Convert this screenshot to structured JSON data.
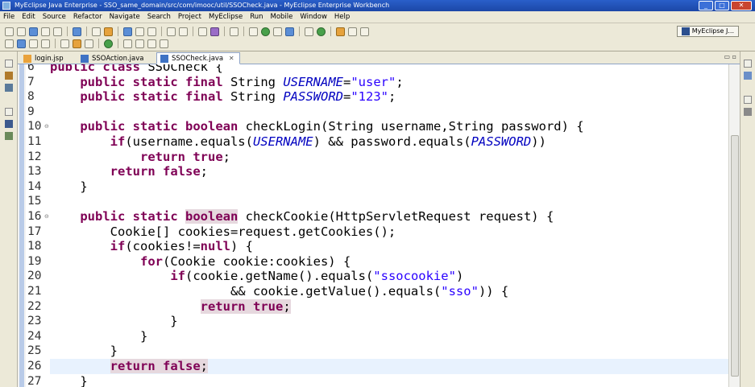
{
  "window": {
    "title": "MyEclipse Java Enterprise - SSO_same_domain/src/com/imooc/util/SSOCheck.java - MyEclipse Enterprise Workbench",
    "minimize": "_",
    "maximize": "□",
    "close": "✕"
  },
  "menu": [
    "File",
    "Edit",
    "Source",
    "Refactor",
    "Navigate",
    "Search",
    "Project",
    "MyEclipse",
    "Run",
    "Mobile",
    "Window",
    "Help"
  ],
  "perspective": {
    "label": "MyEclipse J..."
  },
  "tabs": [
    {
      "label": "login.jsp",
      "icon": "jsp-file-icon"
    },
    {
      "label": "SSOAction.java",
      "icon": "java-file-icon"
    },
    {
      "label": "SSOCheck.java",
      "icon": "java-file-icon",
      "active": true,
      "close": "✕"
    }
  ],
  "tab_controls": "▭ ▫",
  "editor": {
    "lines": [
      {
        "n": "6",
        "fold": "",
        "segs": [
          {
            "t": "kw",
            "v": "public"
          },
          {
            "t": "",
            "v": " "
          },
          {
            "t": "kw",
            "v": "class"
          },
          {
            "t": "",
            "v": " SSOCheck {"
          }
        ]
      },
      {
        "n": "7",
        "fold": "",
        "segs": [
          {
            "t": "",
            "v": "    "
          },
          {
            "t": "kw",
            "v": "public"
          },
          {
            "t": "",
            "v": " "
          },
          {
            "t": "kw",
            "v": "static"
          },
          {
            "t": "",
            "v": " "
          },
          {
            "t": "kw",
            "v": "final"
          },
          {
            "t": "",
            "v": " String "
          },
          {
            "t": "con",
            "v": "USERNAME"
          },
          {
            "t": "",
            "v": "="
          },
          {
            "t": "str",
            "v": "\"user\""
          },
          {
            "t": "",
            "v": ";"
          }
        ]
      },
      {
        "n": "8",
        "fold": "",
        "segs": [
          {
            "t": "",
            "v": "    "
          },
          {
            "t": "kw",
            "v": "public"
          },
          {
            "t": "",
            "v": " "
          },
          {
            "t": "kw",
            "v": "static"
          },
          {
            "t": "",
            "v": " "
          },
          {
            "t": "kw",
            "v": "final"
          },
          {
            "t": "",
            "v": " String "
          },
          {
            "t": "con",
            "v": "PASSWORD"
          },
          {
            "t": "",
            "v": "="
          },
          {
            "t": "str",
            "v": "\"123\""
          },
          {
            "t": "",
            "v": ";"
          }
        ]
      },
      {
        "n": "9",
        "fold": "",
        "segs": []
      },
      {
        "n": "10",
        "fold": "⊖",
        "segs": [
          {
            "t": "",
            "v": "    "
          },
          {
            "t": "kw",
            "v": "public"
          },
          {
            "t": "",
            "v": " "
          },
          {
            "t": "kw",
            "v": "static"
          },
          {
            "t": "",
            "v": " "
          },
          {
            "t": "kw",
            "v": "boolean"
          },
          {
            "t": "",
            "v": " checkLogin(String username,String password) {"
          }
        ]
      },
      {
        "n": "11",
        "fold": "",
        "segs": [
          {
            "t": "",
            "v": "        "
          },
          {
            "t": "kw",
            "v": "if"
          },
          {
            "t": "",
            "v": "(username.equals("
          },
          {
            "t": "con",
            "v": "USERNAME"
          },
          {
            "t": "",
            "v": ") && password.equals("
          },
          {
            "t": "con",
            "v": "PASSWORD"
          },
          {
            "t": "",
            "v": "))"
          }
        ]
      },
      {
        "n": "12",
        "fold": "",
        "segs": [
          {
            "t": "",
            "v": "            "
          },
          {
            "t": "kw",
            "v": "return"
          },
          {
            "t": "",
            "v": " "
          },
          {
            "t": "kw",
            "v": "true"
          },
          {
            "t": "",
            "v": ";"
          }
        ]
      },
      {
        "n": "13",
        "fold": "",
        "segs": [
          {
            "t": "",
            "v": "        "
          },
          {
            "t": "kw",
            "v": "return"
          },
          {
            "t": "",
            "v": " "
          },
          {
            "t": "kw",
            "v": "false"
          },
          {
            "t": "",
            "v": ";"
          }
        ]
      },
      {
        "n": "14",
        "fold": "",
        "segs": [
          {
            "t": "",
            "v": "    }"
          }
        ]
      },
      {
        "n": "15",
        "fold": "",
        "segs": []
      },
      {
        "n": "16",
        "fold": "⊖",
        "segs": [
          {
            "t": "",
            "v": "    "
          },
          {
            "t": "kw",
            "v": "public"
          },
          {
            "t": "",
            "v": " "
          },
          {
            "t": "kw",
            "v": "static"
          },
          {
            "t": "",
            "v": " "
          },
          {
            "t": "kw hl",
            "v": "boolean"
          },
          {
            "t": "",
            "v": " checkCookie(HttpServletRequest request) {"
          }
        ]
      },
      {
        "n": "17",
        "fold": "",
        "segs": [
          {
            "t": "",
            "v": "        Cookie[] cookies=request.getCookies();"
          }
        ]
      },
      {
        "n": "18",
        "fold": "",
        "segs": [
          {
            "t": "",
            "v": "        "
          },
          {
            "t": "kw",
            "v": "if"
          },
          {
            "t": "",
            "v": "(cookies!="
          },
          {
            "t": "kw",
            "v": "null"
          },
          {
            "t": "",
            "v": ") {"
          }
        ]
      },
      {
        "n": "19",
        "fold": "",
        "segs": [
          {
            "t": "",
            "v": "            "
          },
          {
            "t": "kw",
            "v": "for"
          },
          {
            "t": "",
            "v": "(Cookie cookie:cookies) {"
          }
        ]
      },
      {
        "n": "20",
        "fold": "",
        "segs": [
          {
            "t": "",
            "v": "                "
          },
          {
            "t": "kw",
            "v": "if"
          },
          {
            "t": "",
            "v": "(cookie.getName().equals("
          },
          {
            "t": "str",
            "v": "\"ssocookie\""
          },
          {
            "t": "",
            "v": ")"
          }
        ]
      },
      {
        "n": "21",
        "fold": "",
        "segs": [
          {
            "t": "",
            "v": "                        && cookie.getValue().equals("
          },
          {
            "t": "str",
            "v": "\"sso\""
          },
          {
            "t": "",
            "v": ")) {"
          }
        ]
      },
      {
        "n": "22",
        "fold": "",
        "segs": [
          {
            "t": "",
            "v": "                    "
          },
          {
            "t": "kw hl",
            "v": "return"
          },
          {
            "t": "hl",
            "v": " "
          },
          {
            "t": "kw hl",
            "v": "true"
          },
          {
            "t": "hl",
            "v": ";"
          }
        ]
      },
      {
        "n": "23",
        "fold": "",
        "segs": [
          {
            "t": "",
            "v": "                }"
          }
        ]
      },
      {
        "n": "24",
        "fold": "",
        "segs": [
          {
            "t": "",
            "v": "            }"
          }
        ]
      },
      {
        "n": "25",
        "fold": "",
        "segs": [
          {
            "t": "",
            "v": "        }"
          }
        ]
      },
      {
        "n": "26",
        "fold": "",
        "current": true,
        "segs": [
          {
            "t": "",
            "v": "        "
          },
          {
            "t": "kw hl",
            "v": "return"
          },
          {
            "t": "hl",
            "v": " "
          },
          {
            "t": "kw hl",
            "v": "false"
          },
          {
            "t": "hl",
            "v": ";"
          }
        ]
      },
      {
        "n": "27",
        "fold": "",
        "segs": [
          {
            "t": "",
            "v": "    }"
          }
        ]
      },
      {
        "n": "28",
        "fold": "",
        "segs": [
          {
            "t": "",
            "v": "}"
          }
        ]
      }
    ]
  },
  "colors": {
    "keyword": "#7f0055",
    "constant": "#0000c0",
    "string": "#2a00ff",
    "current_line": "#e8f2fe",
    "occurrence": "#e6d8de"
  }
}
